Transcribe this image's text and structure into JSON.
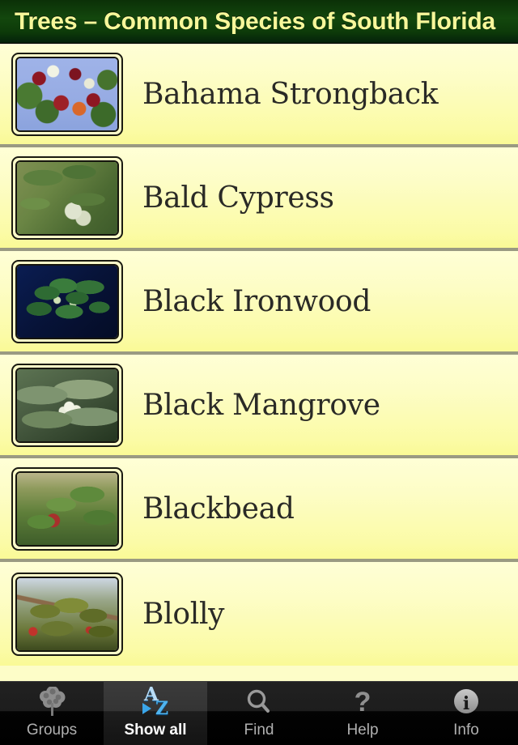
{
  "header": {
    "title": "Trees – Common Species of South Florida",
    "bg_color": "#0e3c0a",
    "text_color": "#f7f79a"
  },
  "list": {
    "row_bg_top": "#ffffd6",
    "row_bg_bottom": "#fafa96",
    "separator_color": "#9a9a82",
    "rows": [
      {
        "label": "Bahama Strongback",
        "thumbnail": "bahama-strongback-photo"
      },
      {
        "label": "Bald Cypress",
        "thumbnail": "bald-cypress-photo"
      },
      {
        "label": "Black Ironwood",
        "thumbnail": "black-ironwood-photo"
      },
      {
        "label": "Black Mangrove",
        "thumbnail": "black-mangrove-photo"
      },
      {
        "label": "Blackbead",
        "thumbnail": "blackbead-photo"
      },
      {
        "label": "Blolly",
        "thumbnail": "blolly-photo"
      }
    ]
  },
  "tabbar": {
    "selected_index": 1,
    "accent_color": "#4fb4ef",
    "tabs": [
      {
        "label": "Groups",
        "icon": "tree-icon"
      },
      {
        "label": "Show all",
        "icon": "a-to-z-icon"
      },
      {
        "label": "Find",
        "icon": "search-icon"
      },
      {
        "label": "Help",
        "icon": "question-mark-icon"
      },
      {
        "label": "Info",
        "icon": "info-icon"
      }
    ]
  }
}
